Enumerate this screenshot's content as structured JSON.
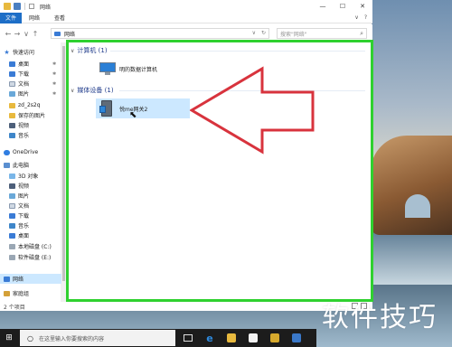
{
  "window": {
    "title": "网络",
    "controls": {
      "minimize": "—",
      "maximize": "☐",
      "close": "✕"
    }
  },
  "ribbon": {
    "tabs": [
      "文件",
      "网络",
      "查看"
    ],
    "right": {
      "collapse": "∨",
      "help": "?"
    }
  },
  "address": {
    "back": "←",
    "forward": "→",
    "dropdown": "∨",
    "up": "↑",
    "path": "网络",
    "refresh": "↻",
    "search_placeholder": "搜索\"网络\""
  },
  "sidebar": {
    "items": [
      {
        "label": "快速访问",
        "icon": "star-icon",
        "pinned": false
      },
      {
        "label": "桌面",
        "icon": "desktop-icon",
        "pinned": true
      },
      {
        "label": "下载",
        "icon": "download-icon",
        "pinned": true
      },
      {
        "label": "文档",
        "icon": "document-icon",
        "pinned": true
      },
      {
        "label": "图片",
        "icon": "pictures-icon",
        "pinned": true
      },
      {
        "label": "zd_2s2q",
        "icon": "folder-icon",
        "pinned": false
      },
      {
        "label": "保存的图片",
        "icon": "folder-icon",
        "pinned": false
      },
      {
        "label": "视频",
        "icon": "video-icon",
        "pinned": false
      },
      {
        "label": "音乐",
        "icon": "music-icon",
        "pinned": false
      },
      {
        "label": "OneDrive",
        "icon": "cloud-icon",
        "pinned": false
      },
      {
        "label": "此电脑",
        "icon": "computer-icon",
        "pinned": false
      },
      {
        "label": "3D 对象",
        "icon": "3d-objects-icon",
        "pinned": false
      },
      {
        "label": "视频",
        "icon": "video-icon",
        "pinned": false
      },
      {
        "label": "图片",
        "icon": "pictures-icon",
        "pinned": false
      },
      {
        "label": "文档",
        "icon": "document-icon",
        "pinned": false
      },
      {
        "label": "下载",
        "icon": "download-icon",
        "pinned": false
      },
      {
        "label": "音乐",
        "icon": "music-icon",
        "pinned": false
      },
      {
        "label": "桌面",
        "icon": "desktop-icon",
        "pinned": false
      },
      {
        "label": "本地磁盘 (C:)",
        "icon": "drive-icon",
        "pinned": false
      },
      {
        "label": "软件磁盘 (E:)",
        "icon": "drive-icon",
        "pinned": false
      },
      {
        "label": "网络",
        "icon": "network-icon",
        "pinned": false,
        "selected": true
      },
      {
        "label": "家庭组",
        "icon": "homegroup-icon",
        "pinned": false
      }
    ]
  },
  "content": {
    "groups": [
      {
        "label": "计算机 (1)",
        "items": [
          {
            "label": "明的数据计算机",
            "icon": "computer-icon"
          }
        ]
      },
      {
        "label": "媒体设备 (1)",
        "items": [
          {
            "label": "悦me网关2",
            "icon": "media-device-icon",
            "selected": true
          }
        ]
      }
    ]
  },
  "status": {
    "text": "2 个项目"
  },
  "taskbar": {
    "search_placeholder": "在这里输入你要搜索的内容"
  },
  "watermark": "软件技巧",
  "colors": {
    "accent": "#1d6ec7",
    "highlight_box": "#2fd12f",
    "arrow": "#d8333d",
    "selection": "#cce8ff"
  }
}
